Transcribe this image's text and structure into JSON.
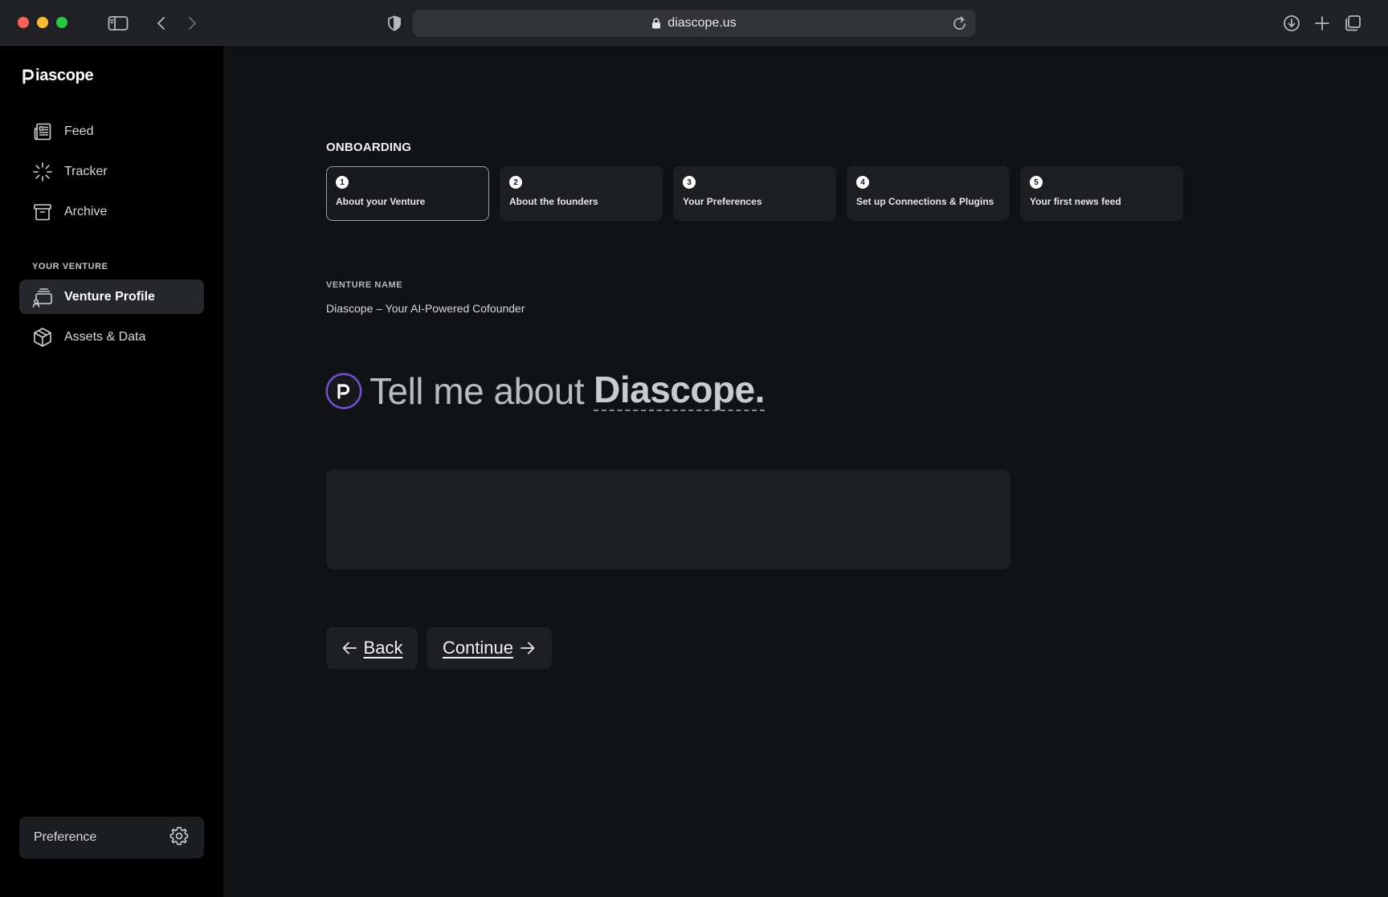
{
  "browser": {
    "url": "diascope.us"
  },
  "sidebar": {
    "brand": "iascope",
    "nav": [
      {
        "label": "Feed",
        "icon": "newspaper-icon"
      },
      {
        "label": "Tracker",
        "icon": "loader-icon"
      },
      {
        "label": "Archive",
        "icon": "archive-icon"
      }
    ],
    "section_label": "YOUR VENTURE",
    "venture_nav": [
      {
        "label": "Venture Profile",
        "icon": "venture-profile-icon",
        "active": true
      },
      {
        "label": "Assets & Data",
        "icon": "package-icon"
      }
    ],
    "preference_label": "Preference"
  },
  "onboarding": {
    "title": "ONBOARDING",
    "steps": [
      {
        "num": "1",
        "label": "About your Venture",
        "active": true
      },
      {
        "num": "2",
        "label": "About the founders"
      },
      {
        "num": "3",
        "label": "Your Preferences"
      },
      {
        "num": "4",
        "label": "Set up Connections & Plugins"
      },
      {
        "num": "5",
        "label": "Your first news feed"
      }
    ],
    "venture_name_label": "VENTURE NAME",
    "venture_name_value": "Diascope – Your AI-Powered Cofounder",
    "prompt_text": "Tell me about",
    "prompt_name": "Diascope.",
    "answer_value": "",
    "back_label": "Back",
    "continue_label": "Continue"
  },
  "colors": {
    "background": "#111214",
    "sidebar": "#000000",
    "accent": "#7a55d6"
  }
}
